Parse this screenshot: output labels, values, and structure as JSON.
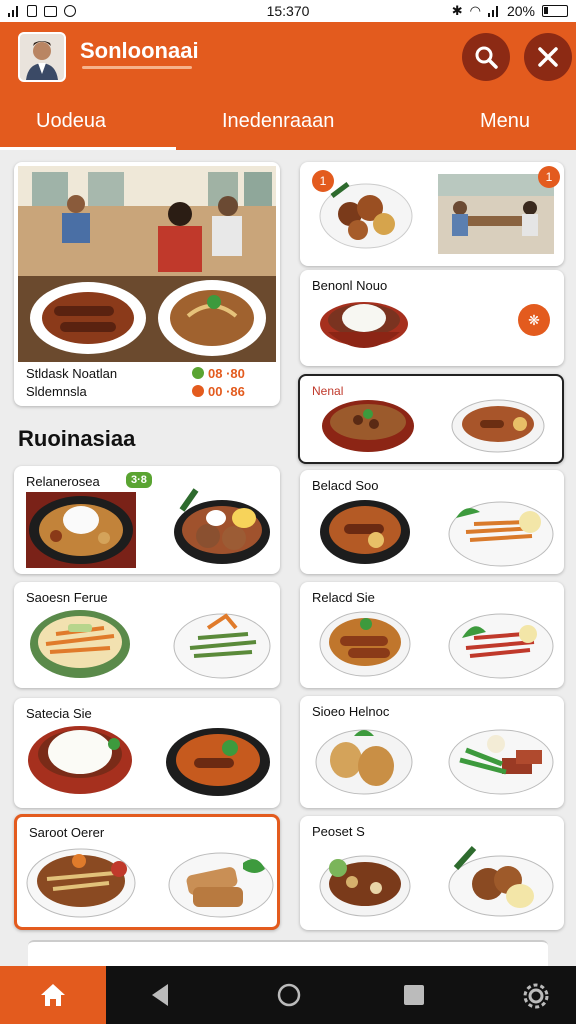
{
  "status_bar": {
    "time": "15:370",
    "battery": "20%"
  },
  "app_bar": {
    "title": "Sonloonaai"
  },
  "tabs": [
    {
      "label": "Uodeua"
    },
    {
      "label": "Inedenraaan"
    },
    {
      "label": "Menu"
    }
  ],
  "featured": {
    "line1": "Stldask Noatlan",
    "line2": "Sldemnsla",
    "price1": "08 ·80",
    "price2": "00 ·86"
  },
  "right_top": {
    "badge1": "1",
    "badge2": "1"
  },
  "right_cards": [
    {
      "title": "Benonl Nouo"
    },
    {
      "title": "Nenal"
    },
    {
      "title": "Belacd Soo"
    },
    {
      "title": "Relacd Sie"
    },
    {
      "title": "Sioeo Helnoc"
    },
    {
      "title": "Peoset S"
    }
  ],
  "section_title": "Ruoinasiaa",
  "left_cards": [
    {
      "title": "Relanerosea",
      "badge": "3·8"
    },
    {
      "title": "Saoesn Ferue"
    },
    {
      "title": "Satecia Sie"
    },
    {
      "title": "Saroot Oerer"
    }
  ],
  "icons": [
    "search-icon",
    "close-icon",
    "home-icon",
    "back-icon",
    "recents-icon",
    "settings-icon"
  ],
  "colors": {
    "primary": "#e35b1e",
    "button_dark": "#8c2a14",
    "badge_green": "#5aa432"
  }
}
